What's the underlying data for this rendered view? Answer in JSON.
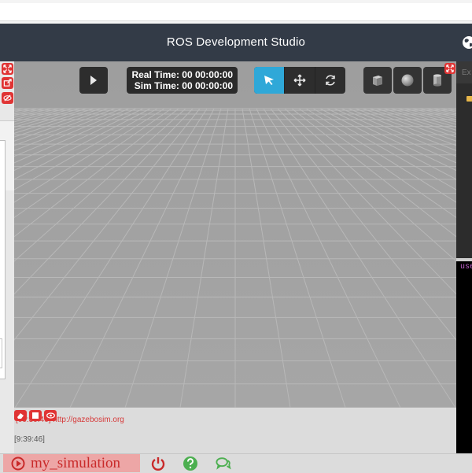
{
  "app": {
    "title": "ROS Development Studio"
  },
  "gazebo": {
    "time": {
      "real_label": "Real Time:",
      "real_value": "00 00:00:00",
      "sim_label": "Sim Time:",
      "sim_value": "00 00:00:00"
    },
    "tools": [
      {
        "name": "select",
        "icon": "cursor-arrow-icon",
        "active": true
      },
      {
        "name": "translate",
        "icon": "move-arrows-icon",
        "active": false
      },
      {
        "name": "rotate",
        "icon": "rotate-icon",
        "active": false
      }
    ],
    "shapes": [
      "box-icon",
      "sphere-icon",
      "cylinder-icon"
    ]
  },
  "console": {
    "line1": "[09:39:46] http://gazebosim.org",
    "line2": "[9:39:46]"
  },
  "ide": {
    "files_header": "Ex",
    "terminal_prompt": "user"
  },
  "bottom": {
    "simulation_label": "my_simulation"
  },
  "colors": {
    "header_bg": "#333b47",
    "accent_red": "#e03434",
    "tool_active": "#2fa8d8",
    "help_green": "#4caf50"
  }
}
